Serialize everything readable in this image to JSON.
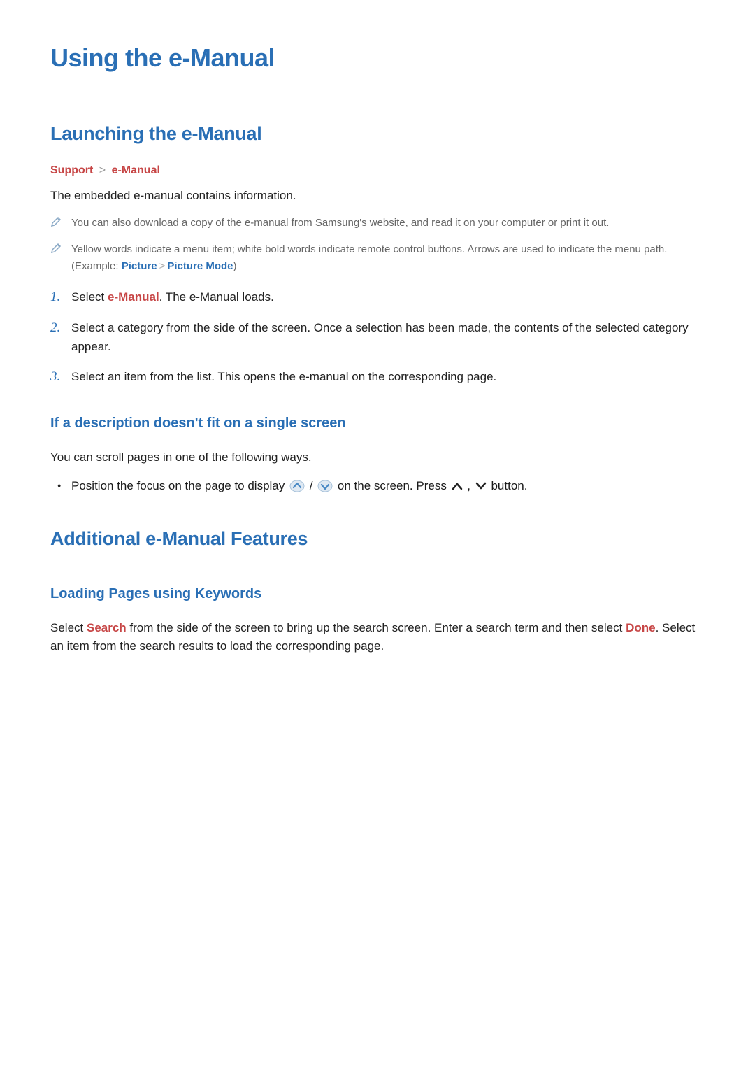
{
  "title": "Using the e-Manual",
  "section1": {
    "heading": "Launching the e-Manual",
    "breadcrumb": {
      "a": "Support",
      "sep": ">",
      "b": "e-Manual"
    },
    "intro": "The embedded e-manual contains information.",
    "notes": [
      {
        "text": "You can also download a copy of the e-manual from Samsung's website, and read it on your computer or print it out."
      },
      {
        "pre": "Yellow words indicate a menu item; white bold words indicate remote control buttons. Arrows are used to indicate the menu path. (Example: ",
        "ex_a": "Picture",
        "ex_sep": ">",
        "ex_b": "Picture Mode",
        "post": ")"
      }
    ],
    "steps": [
      {
        "pre": "Select ",
        "accent": "e-Manual",
        "post": ". The e-Manual loads."
      },
      {
        "text": "Select a category from the side of the screen. Once a selection has been made, the contents of the selected category appear."
      },
      {
        "text": "Select an item from the list. This opens the e-manual on the corresponding page."
      }
    ],
    "sub": {
      "heading": "If a description doesn't fit on a single screen",
      "line": "You can scroll pages in one of the following ways.",
      "bullet": {
        "pre": "Position the focus on the page to display ",
        "slash": " / ",
        "mid": " on the screen. Press ",
        "comma": ", ",
        "post": " button."
      }
    }
  },
  "section2": {
    "heading": "Additional e-Manual Features",
    "sub": {
      "heading": "Loading Pages using Keywords",
      "p1_pre": "Select ",
      "p1_a": "Search",
      "p1_mid": " from the side of the screen to bring up the search screen. Enter a search term and then select ",
      "p1_b": "Done",
      "p1_post": ". Select an item from the search results to load the corresponding page."
    }
  }
}
